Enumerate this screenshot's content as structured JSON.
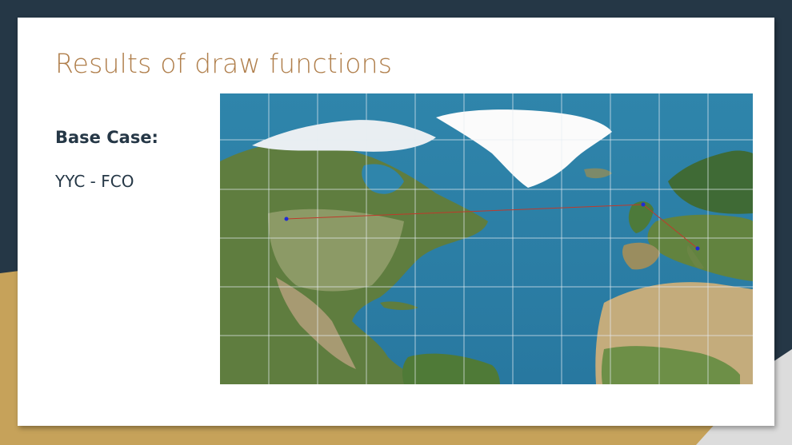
{
  "slide": {
    "title": "Results of draw functions",
    "heading": "Base Case:",
    "route": "YYC - FCO"
  },
  "map": {
    "route_color": "#c0392b",
    "point_color": "#1f2bd6",
    "ocean_color": "#2b7fa6",
    "waypoints": [
      "YYC",
      "LHR",
      "FCO"
    ]
  },
  "theme": {
    "background": "#253746",
    "accent": "#b07f4c",
    "gold": "#c6a25a"
  }
}
